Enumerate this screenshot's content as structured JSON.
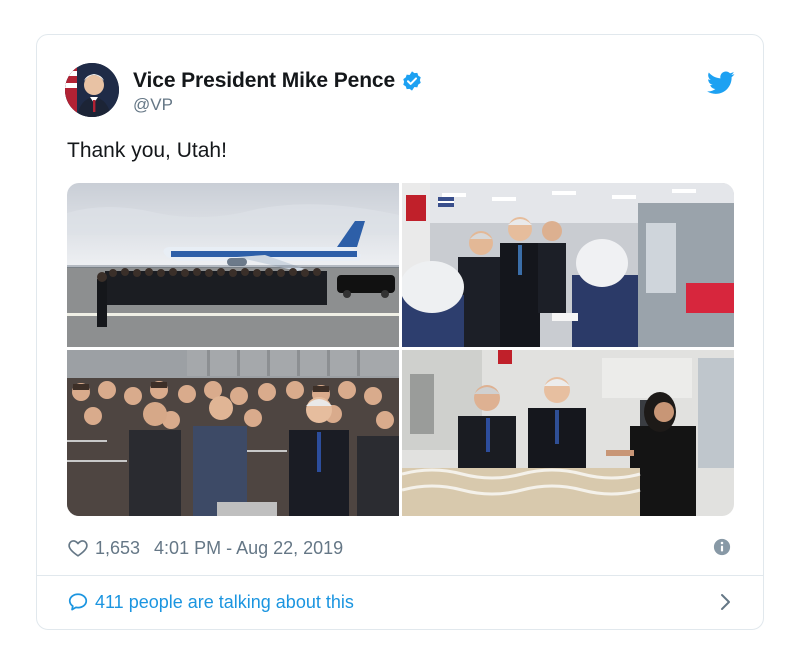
{
  "tweet": {
    "author_name": "Vice President Mike Pence",
    "handle": "@VP",
    "text": "Thank you, Utah!",
    "likes": "1,653",
    "timestamp": "4:01 PM - Aug 22, 2019",
    "talking": "411 people are talking about this"
  },
  "icons": {
    "avatar": "avatar-portrait",
    "verified": "verified-badge-icon",
    "logo": "twitter-bird-icon",
    "like": "heart-icon",
    "info": "info-icon",
    "reply": "speech-bubble-icon",
    "more": "chevron-right-icon"
  },
  "colors": {
    "brand": "#1da1f2",
    "link": "#1b95e0",
    "muted": "#657786",
    "border": "#e1e8ed"
  }
}
